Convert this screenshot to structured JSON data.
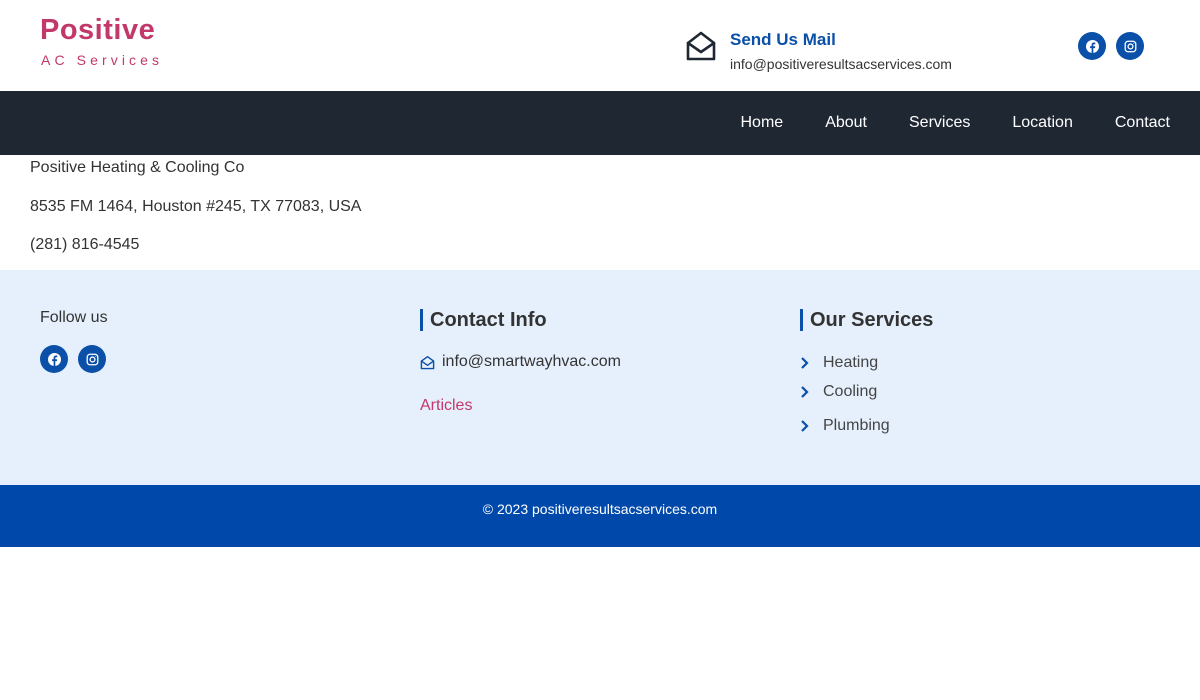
{
  "header": {
    "logo_title": "Positive",
    "logo_subtitle": "AC Services",
    "mail_title": "Send Us Mail",
    "mail_address": "info@positiveresultsacservices.com",
    "social": [
      "facebook-icon",
      "instagram-icon"
    ]
  },
  "nav": {
    "items": [
      {
        "label": "Home"
      },
      {
        "label": "About"
      },
      {
        "label": "Services"
      },
      {
        "label": "Location"
      },
      {
        "label": "Contact"
      }
    ]
  },
  "info": {
    "business_name": "Positive Heating & Cooling Co",
    "address": "8535 FM 1464, Houston #245, TX 77083, USA",
    "phone": "(281) 816-4545"
  },
  "footer": {
    "follow_label": "Follow us",
    "contact_heading": "Contact Info",
    "contact_email": "info@smartwayhvac.com",
    "articles_link": "Articles",
    "services_heading": "Our Services",
    "services": [
      {
        "label": "Heating"
      },
      {
        "label": "Cooling"
      },
      {
        "label": "Plumbing"
      }
    ]
  },
  "copyright": {
    "text": "© 2023 positiveresultsacservices.com"
  },
  "colors": {
    "brand_pink": "#c2386a",
    "brand_blue": "#0a4fa8",
    "nav_bg": "#1f2733",
    "footer_bg": "#e6f0fc",
    "copyright_bg": "#0049aa"
  }
}
